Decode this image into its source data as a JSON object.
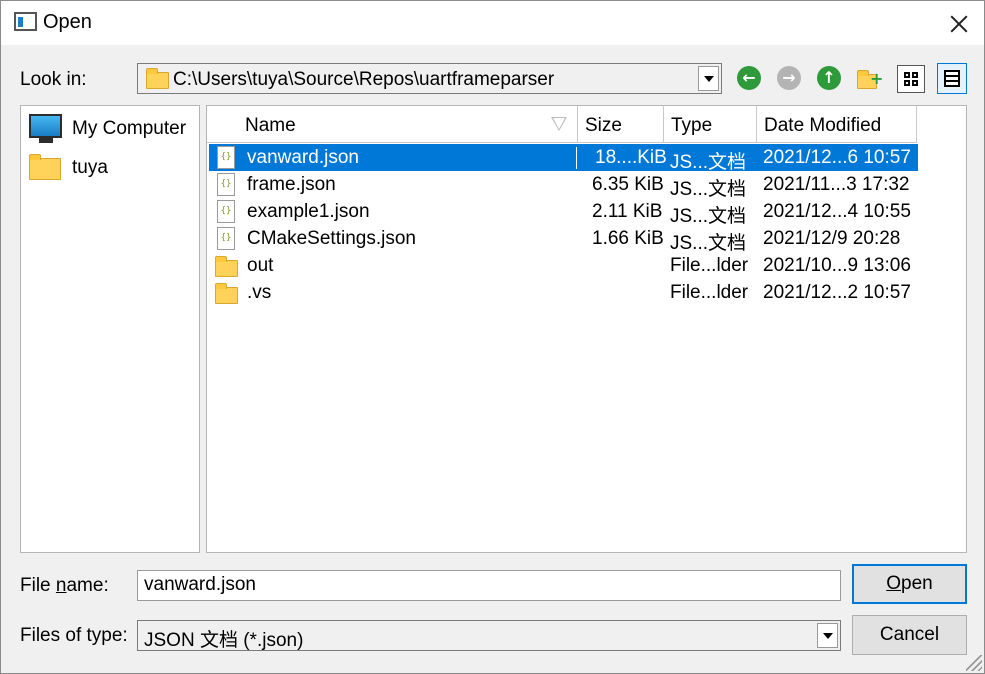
{
  "window": {
    "title": "Open",
    "close_icon": "close-icon"
  },
  "look_in": {
    "label": "Look in:",
    "path": "C:\\Users\\tuya\\Source\\Repos\\uartframeparser"
  },
  "toolbar": {
    "back_icon": "back-icon",
    "forward_icon": "forward-icon",
    "up_icon": "up-folder-icon",
    "new_folder_icon": "new-folder-icon",
    "list_view_icon": "list-view-icon",
    "detail_view_icon": "detail-view-icon"
  },
  "sidebar": {
    "items": [
      {
        "label": "My Computer",
        "icon": "computer-icon"
      },
      {
        "label": "tuya",
        "icon": "folder-icon"
      }
    ]
  },
  "columns": {
    "name": "Name",
    "size": "Size",
    "type": "Type",
    "date": "Date Modified"
  },
  "files": [
    {
      "name": "vanward.json",
      "size": "18....KiB",
      "type": "JS...文档",
      "date": "2021/12...6 10:57",
      "icon": "json-file-icon",
      "selected": true
    },
    {
      "name": "frame.json",
      "size": "6.35 KiB",
      "type": "JS...文档",
      "date": "2021/11...3 17:32",
      "icon": "json-file-icon"
    },
    {
      "name": "example1.json",
      "size": "2.11 KiB",
      "type": "JS...文档",
      "date": "2021/12...4 10:55",
      "icon": "json-file-icon"
    },
    {
      "name": "CMakeSettings.json",
      "size": "1.66 KiB",
      "type": "JS...文档",
      "date": "2021/12/9 20:28",
      "icon": "json-file-icon"
    },
    {
      "name": "out",
      "size": "",
      "type": "File...lder",
      "date": "2021/10...9 13:06",
      "icon": "folder-icon"
    },
    {
      "name": ".vs",
      "size": "",
      "type": "File...lder",
      "date": "2021/12...2 10:57",
      "icon": "folder-icon"
    }
  ],
  "file_name": {
    "label_pre": "File ",
    "label_u": "n",
    "label_post": "ame:",
    "value": "vanward.json"
  },
  "file_type": {
    "label": "Files of type:",
    "value": "JSON 文档 (*.json)"
  },
  "buttons": {
    "open_u": "O",
    "open_rest": "pen",
    "cancel": "Cancel"
  }
}
